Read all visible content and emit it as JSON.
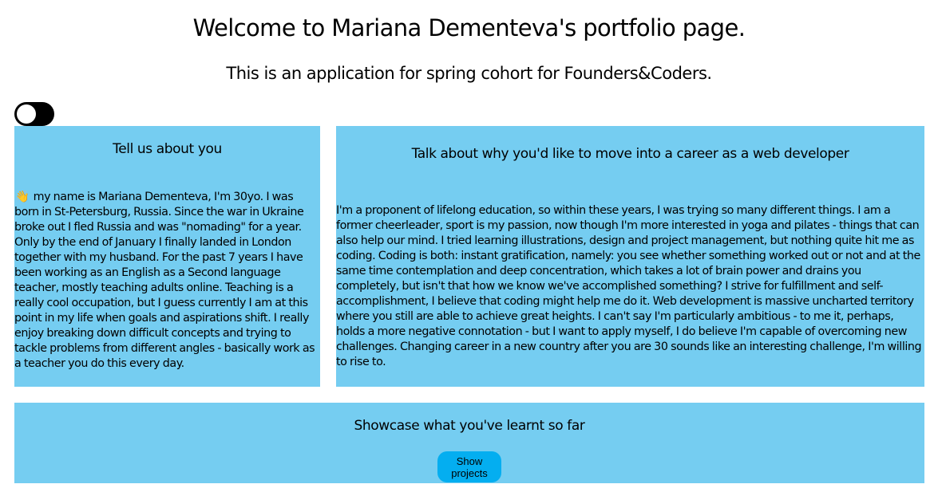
{
  "header": {
    "title": "Welcome to Mariana Dementeva's portfolio page.",
    "subtitle": "This is an application for spring cohort for Founders&Coders."
  },
  "theme_toggle": {
    "state": "off"
  },
  "about": {
    "heading": "Tell us about you",
    "emoji": "👋",
    "text": " my name is Mariana Dementeva, I'm 30yo. I was born in St-Petersburg, Russia. Since the war in Ukraine broke out I fled Russia and was \"nomading\" for a year. Only by the end of January I finally landed in London together with my husband. For the past 7 years I have been working as an English as a Second language teacher, mostly teaching adults online. Teaching is a really cool occupation, but I guess currently I am at this point in my life when goals and aspirations shift. I really enjoy breaking down difficult concepts and trying to tackle problems from different angles - basically work as a teacher you do this every day."
  },
  "career": {
    "heading": "Talk about why you'd like to move into a career as a web developer",
    "text": "I'm a proponent of lifelong education, so within these years, I was trying so many different things. I am a former cheerleader, sport is my passion, now though I'm more interested in yoga and pilates - things that can also help our mind. I tried learning illustrations, design and project management, but nothing quite hit me as coding. Coding is both: instant gratification, namely: you see whether something worked out or not and at the same time contemplation and deep concentration, which takes a lot of brain power and drains you completely, but isn't that how we know we've accomplished something? I strive for fulfillment and self-accomplishment, I believe that coding might help me do it. Web development is massive uncharted territory where you still are able to achieve great heights. I can't say I'm particularly ambitious - to me it, perhaps, holds a more negative connotation - but I want to apply myself, I do believe I'm capable of overcoming new challenges. Changing career in a new country after you are 30 sounds like an interesting challenge, I'm willing to rise to."
  },
  "showcase": {
    "heading": "Showcase what you've learnt so far",
    "button_label": "Show projects"
  },
  "colors": {
    "card_background": "#75cdf1",
    "button_background": "#04aef0",
    "toggle_background": "#000000"
  }
}
